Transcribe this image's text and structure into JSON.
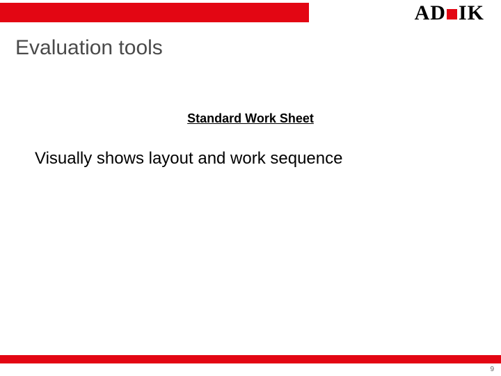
{
  "logo": {
    "prefix": "AD",
    "suffix": "IK"
  },
  "title": "Evaluation tools",
  "subheading": "Standard Work Sheet",
  "body": "Visually shows layout and work sequence",
  "page_number": "9"
}
